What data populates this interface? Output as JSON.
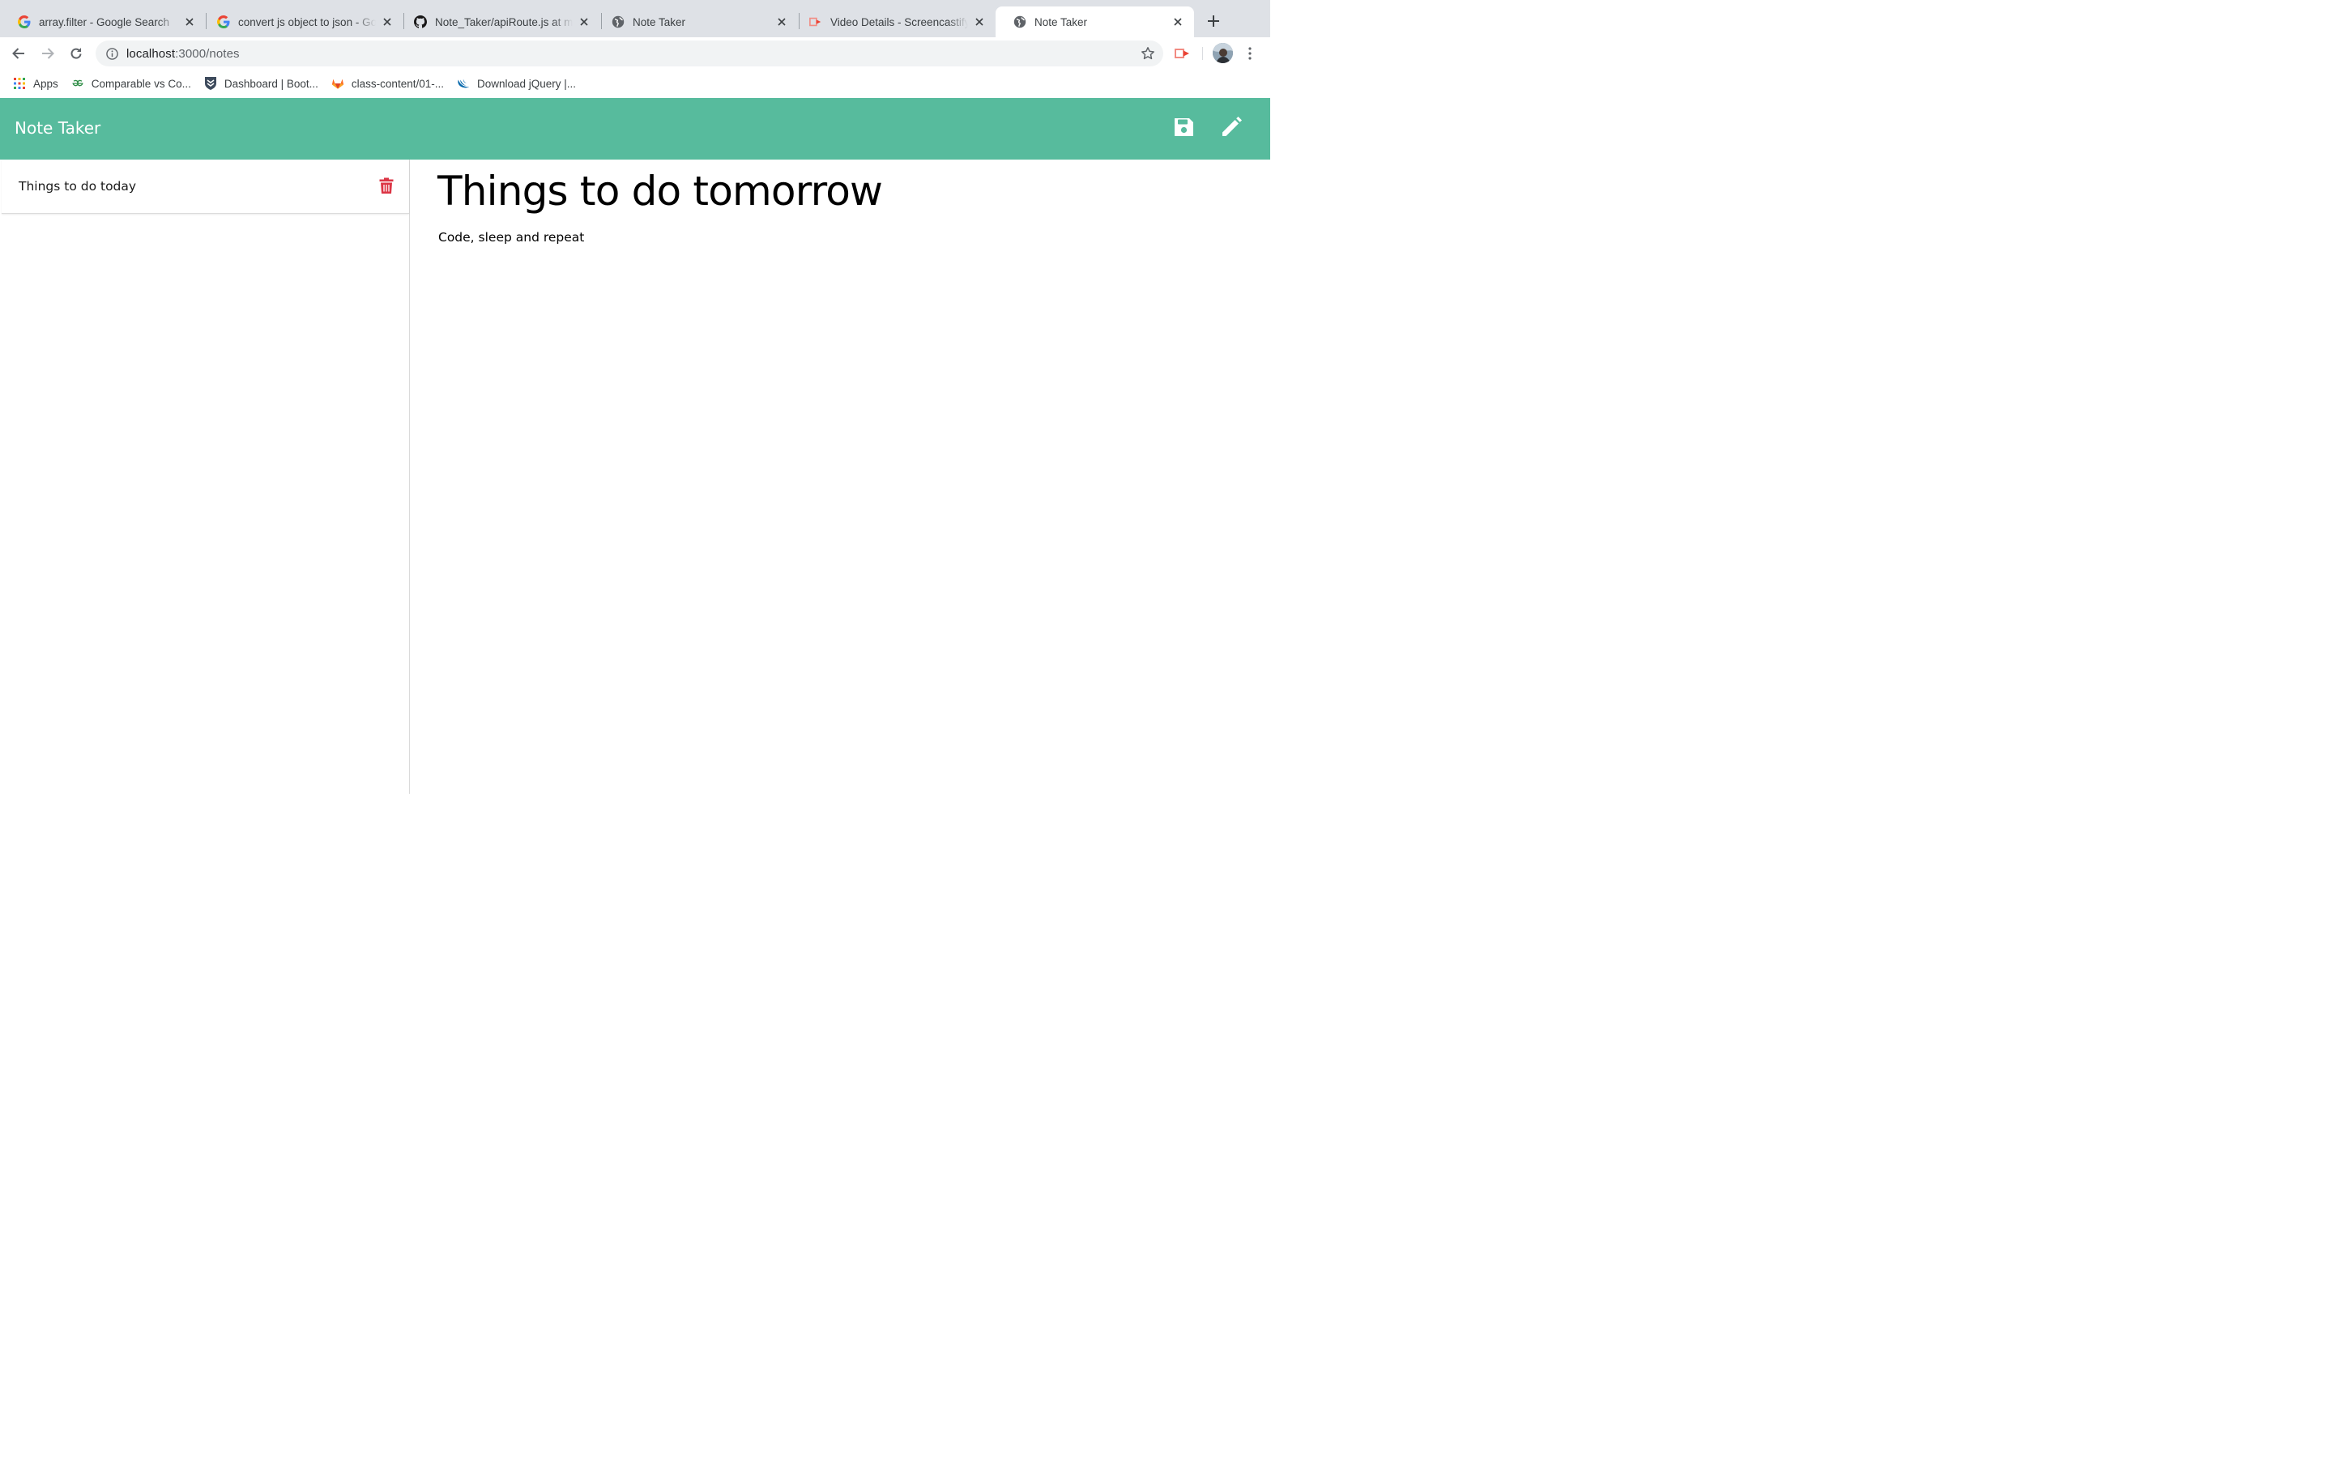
{
  "browser": {
    "tabs": [
      {
        "title": "array.filter - Google Search",
        "icon": "google-icon"
      },
      {
        "title": "convert js object to json - Google Search",
        "icon": "google-icon"
      },
      {
        "title": "Note_Taker/apiRoute.js at master",
        "icon": "github-icon"
      },
      {
        "title": "Note Taker",
        "icon": "globe-icon"
      },
      {
        "title": "Video Details - Screencastify",
        "icon": "screencastify-icon"
      },
      {
        "title": "Note Taker",
        "icon": "globe-icon",
        "active": true
      }
    ],
    "address": {
      "host": "localhost",
      "path": ":3000/notes"
    },
    "bookmarks": [
      {
        "label": "Apps",
        "icon": "apps-grid-icon"
      },
      {
        "label": "Comparable vs Co...",
        "icon": "geeksforgeeks-icon"
      },
      {
        "label": "Dashboard | Boot...",
        "icon": "bootcamp-shield-icon"
      },
      {
        "label": "class-content/01-...",
        "icon": "gitlab-icon"
      },
      {
        "label": "Download jQuery |...",
        "icon": "jquery-icon"
      }
    ]
  },
  "app": {
    "title": "Note Taker",
    "accent_color": "#57bb9d",
    "delete_color": "#dc3545",
    "notes": [
      {
        "title": "Things to do today"
      }
    ],
    "active_note": {
      "title": "Things to do tomorrow",
      "text": "Code, sleep and repeat"
    }
  }
}
